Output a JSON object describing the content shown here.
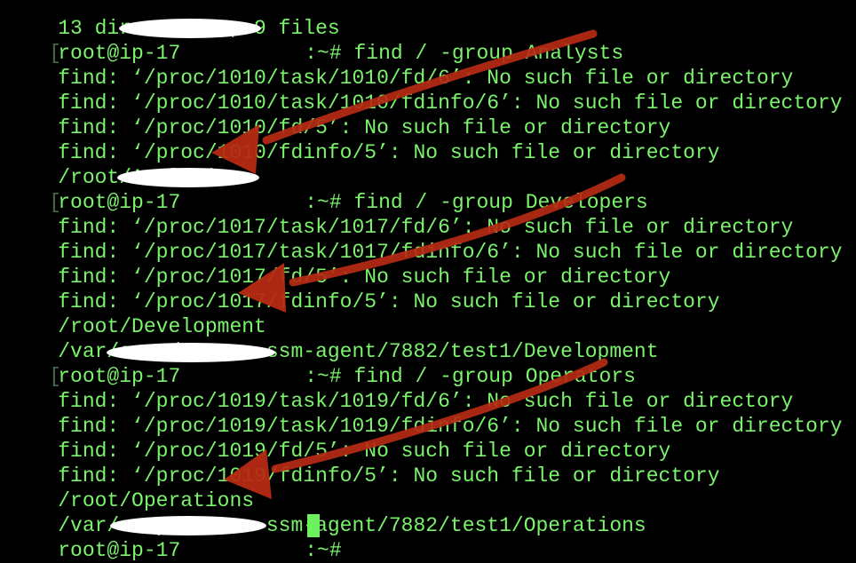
{
  "colors": {
    "background": "#000000",
    "text": "#7cf36c",
    "cursor": "#6cf25e",
    "annotation_arrow": "#b52a14",
    "redaction": "#ffffff"
  },
  "terminal": {
    "lines": [
      {
        "kind": "output",
        "text": "13 directories, 9 files"
      },
      {
        "kind": "prompt",
        "prefix": "root@ip-17",
        "suffix": ":~#",
        "command": " find / -group Analysts"
      },
      {
        "kind": "output",
        "text": "find: ‘/proc/1010/task/1010/fd/6’: No such file or directory"
      },
      {
        "kind": "output",
        "text": "find: ‘/proc/1010/task/1010/fdinfo/6’: No such file or directory"
      },
      {
        "kind": "output",
        "text": "find: ‘/proc/1010/fd/5’: No such file or directory"
      },
      {
        "kind": "output",
        "text": "find: ‘/proc/1010/fdinfo/5’: No such file or directory"
      },
      {
        "kind": "output",
        "text": "/root/Analytics"
      },
      {
        "kind": "prompt",
        "prefix": "root@ip-17",
        "suffix": ":~#",
        "command": " find / -group Developers"
      },
      {
        "kind": "output",
        "text": "find: ‘/proc/1017/task/1017/fd/6’: No such file or directory"
      },
      {
        "kind": "output",
        "text": "find: ‘/proc/1017/task/1017/fdinfo/6’: No such file or directory"
      },
      {
        "kind": "output",
        "text": "find: ‘/proc/1017/fd/5’: No such file or directory"
      },
      {
        "kind": "output",
        "text": "find: ‘/proc/1017/fdinfo/5’: No such file or directory"
      },
      {
        "kind": "output",
        "text": "/root/Development"
      },
      {
        "kind": "output",
        "text": "/var/snap/amazon-ssm-agent/7882/test1/Development"
      },
      {
        "kind": "prompt",
        "prefix": "root@ip-17",
        "suffix": ":~#",
        "command": " find / -group Operators"
      },
      {
        "kind": "output",
        "text": "find: ‘/proc/1019/task/1019/fd/6’: No such file or directory"
      },
      {
        "kind": "output",
        "text": "find: ‘/proc/1019/task/1019/fdinfo/6’: No such file or directory"
      },
      {
        "kind": "output",
        "text": "find: ‘/proc/1019/fd/5’: No such file or directory"
      },
      {
        "kind": "output",
        "text": "find: ‘/proc/1019/fdinfo/5’: No such file or directory"
      },
      {
        "kind": "output",
        "text": "/root/Operations"
      },
      {
        "kind": "output",
        "text": "/var/snap/amazon-ssm-agent/7882/test1/Operations"
      },
      {
        "kind": "prompt",
        "prefix": "root@ip-17",
        "suffix": ":~#",
        "command": " "
      }
    ]
  }
}
